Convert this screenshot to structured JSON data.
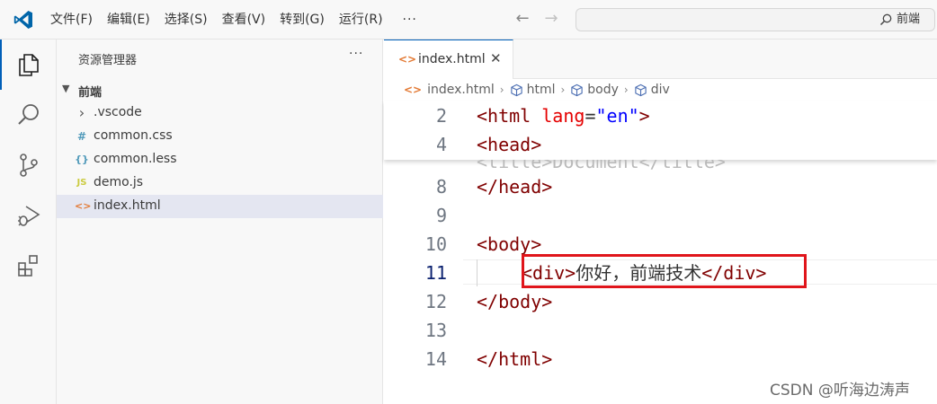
{
  "menu": [
    "文件(F)",
    "编辑(E)",
    "选择(S)",
    "查看(V)",
    "转到(G)",
    "运行(R)"
  ],
  "menu_more": "···",
  "command_center": {
    "text": "前端"
  },
  "activity": [
    "explorer-icon",
    "search-icon",
    "source-control-icon",
    "run-debug-icon",
    "extensions-icon"
  ],
  "sidebar": {
    "title": "资源管理器",
    "more": "···",
    "folder": "前端",
    "files": [
      {
        "name": ".vscode",
        "icon": "›",
        "icon_color": "#555555"
      },
      {
        "name": "common.css",
        "icon": "#",
        "icon_color": "#519aba"
      },
      {
        "name": "common.less",
        "icon": "{}",
        "icon_color": "#519aba"
      },
      {
        "name": "demo.js",
        "icon": "JS",
        "icon_color": "#cbcb41"
      },
      {
        "name": "index.html",
        "icon": "<>",
        "icon_color": "#e37933"
      }
    ]
  },
  "tab": {
    "label": "index.html",
    "close": "✕"
  },
  "breadcrumb": {
    "file": "index.html",
    "items": [
      "html",
      "body",
      "div"
    ]
  },
  "code": {
    "sticky": [
      {
        "num": "2",
        "tag": "<html",
        "attr": " lang",
        "eq": "=",
        "str": "\"en\"",
        "end": ">"
      },
      {
        "num": "4",
        "tag": "<head>"
      }
    ],
    "ghost_text": "<title>Document</title>",
    "lines": [
      {
        "num": "8",
        "code": "</head>"
      },
      {
        "num": "9",
        "code": ""
      },
      {
        "num": "10",
        "code": "<body>"
      },
      {
        "num": "11",
        "open": "<div>",
        "text": "你好，前端技术",
        "close": "</div>"
      },
      {
        "num": "12",
        "code": "</body>"
      },
      {
        "num": "13",
        "code": ""
      },
      {
        "num": "14",
        "code": "</html>"
      }
    ]
  },
  "watermark": "CSDN @听海边涛声"
}
